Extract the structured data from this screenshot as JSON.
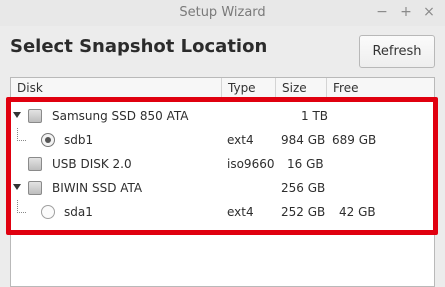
{
  "window": {
    "title": "Setup Wizard",
    "minimize_glyph": "−",
    "maximize_glyph": "+",
    "close_glyph": "×"
  },
  "page": {
    "heading": "Select Snapshot Location",
    "refresh_label": "Refresh"
  },
  "table": {
    "columns": [
      "Disk",
      "Type",
      "Size",
      "Free"
    ],
    "rows": [
      {
        "kind": "disk",
        "name": "Samsung SSD 850 ATA",
        "type": "",
        "size": "1 TB",
        "free": ""
      },
      {
        "kind": "partition-selected",
        "name": "sdb1",
        "type": "ext4",
        "size": "984 GB",
        "free": "689 GB"
      },
      {
        "kind": "disk-plain",
        "name": "USB DISK 2.0",
        "type": "iso9660",
        "size": "16 GB",
        "free": ""
      },
      {
        "kind": "disk",
        "name": "BIWIN SSD ATA",
        "type": "",
        "size": "256 GB",
        "free": ""
      },
      {
        "kind": "partition",
        "name": "sda1",
        "type": "ext4",
        "size": "252 GB",
        "free": "42 GB"
      }
    ]
  },
  "colors": {
    "highlight": "#e0000f"
  }
}
